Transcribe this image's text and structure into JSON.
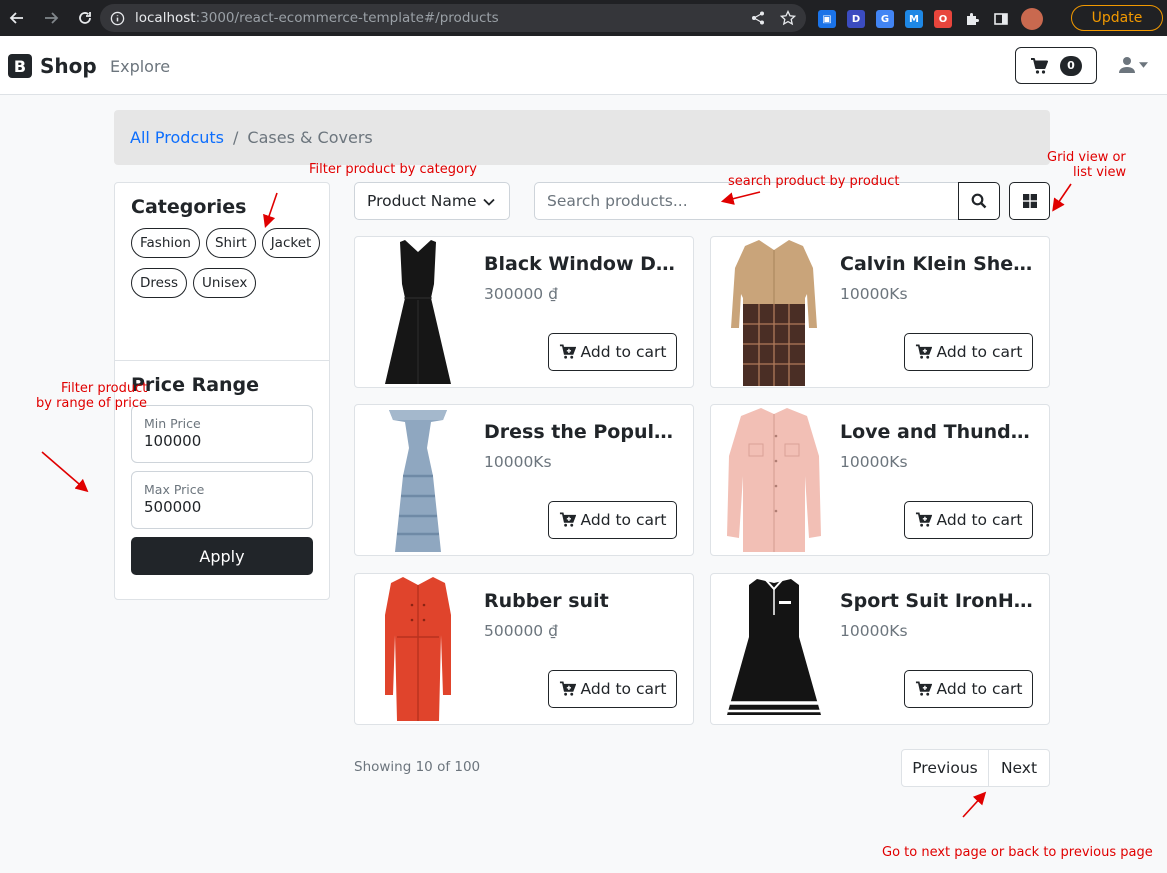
{
  "browser": {
    "url_host": "localhost",
    "url_rest": ":3000/react-ecommerce-template#/products",
    "update_label": "Update"
  },
  "navbar": {
    "brand_logo": "B",
    "brand_name": "Shop",
    "explore_label": "Explore",
    "cart_count": "0"
  },
  "breadcrumb": {
    "root": "All Prodcuts",
    "separator": "/",
    "current": "Cases & Covers"
  },
  "sidebar": {
    "categories_title": "Categories",
    "categories": [
      "Fashion",
      "Shirt",
      "Jacket",
      "Dress",
      "Unisex"
    ],
    "price_title": "Price Range",
    "min_label": "Min Price",
    "min_value": "100000",
    "max_label": "Max Price",
    "max_value": "500000",
    "apply_label": "Apply"
  },
  "toolbar": {
    "sort_value": "Product Name",
    "search_placeholder": "Search products..."
  },
  "products": [
    {
      "name": "Black Window Dress",
      "price": "300000 ₫",
      "button": "Add to cart"
    },
    {
      "name": "Calvin Klein Sheath Trench",
      "price": "10000Ks",
      "button": "Add to cart"
    },
    {
      "name": "Dress the Population Maxi",
      "price": "10000Ks",
      "button": "Add to cart"
    },
    {
      "name": "Love and Thunder Shirt",
      "price": "10000Ks",
      "button": "Add to cart"
    },
    {
      "name": "Rubber suit",
      "price": "500000 ₫",
      "button": "Add to cart"
    },
    {
      "name": "Sport Suit IronHeart",
      "price": "10000Ks",
      "button": "Add to cart"
    }
  ],
  "footer": {
    "showing": "Showing 10 of 100",
    "previous": "Previous",
    "next": "Next"
  },
  "annotations": {
    "category": "Filter product by category",
    "search": "search product by product",
    "view_line1": "Grid view or",
    "view_line2": "list view",
    "price_line1": "Filter product",
    "price_line2": "by range of price",
    "pagination": "Go to next page or back to previous page"
  },
  "colors": {
    "primary_link": "#0d6efd",
    "dark": "#212529",
    "annotation": "#e00000",
    "update_accent": "#f29900"
  }
}
